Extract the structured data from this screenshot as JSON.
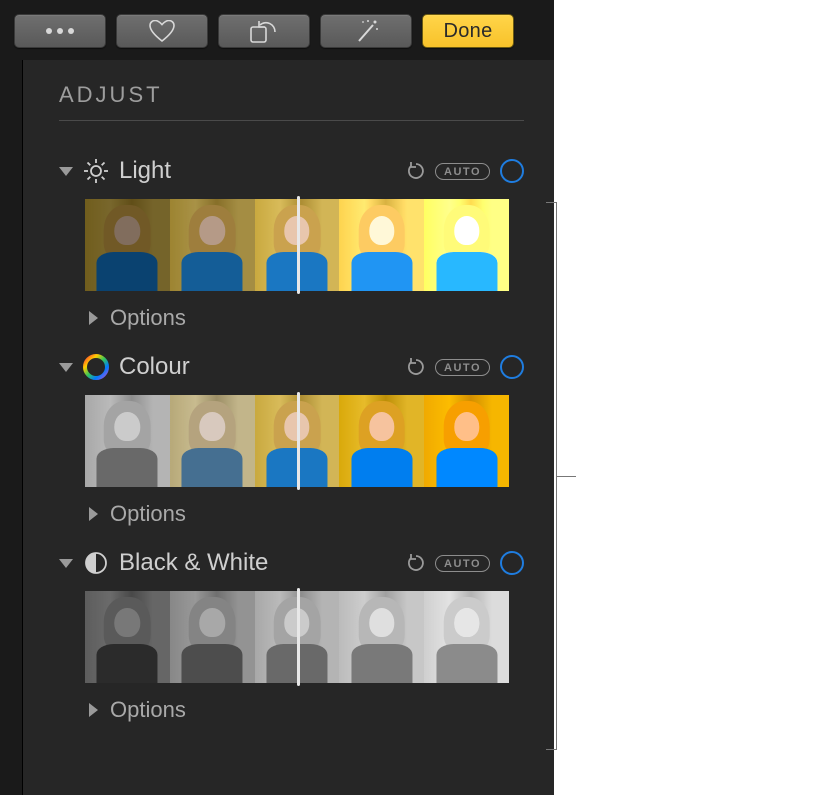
{
  "toolbar": {
    "more_label": "More",
    "favorite_label": "Favorite",
    "rotate_label": "Rotate",
    "enhance_label": "Auto Enhance",
    "done_label": "Done"
  },
  "panel": {
    "title": "ADJUST"
  },
  "sections": [
    {
      "id": "light",
      "label": "Light",
      "icon": "brightness-icon",
      "auto_label": "AUTO",
      "options_label": "Options",
      "slider_position_percent": 50
    },
    {
      "id": "colour",
      "label": "Colour",
      "icon": "colour-wheel-icon",
      "auto_label": "AUTO",
      "options_label": "Options",
      "slider_position_percent": 50
    },
    {
      "id": "bw",
      "label": "Black & White",
      "icon": "half-circle-icon",
      "auto_label": "AUTO",
      "options_label": "Options",
      "slider_position_percent": 50
    }
  ],
  "colors": {
    "accent": "#1f7de0",
    "done_button": "#f9c631"
  }
}
